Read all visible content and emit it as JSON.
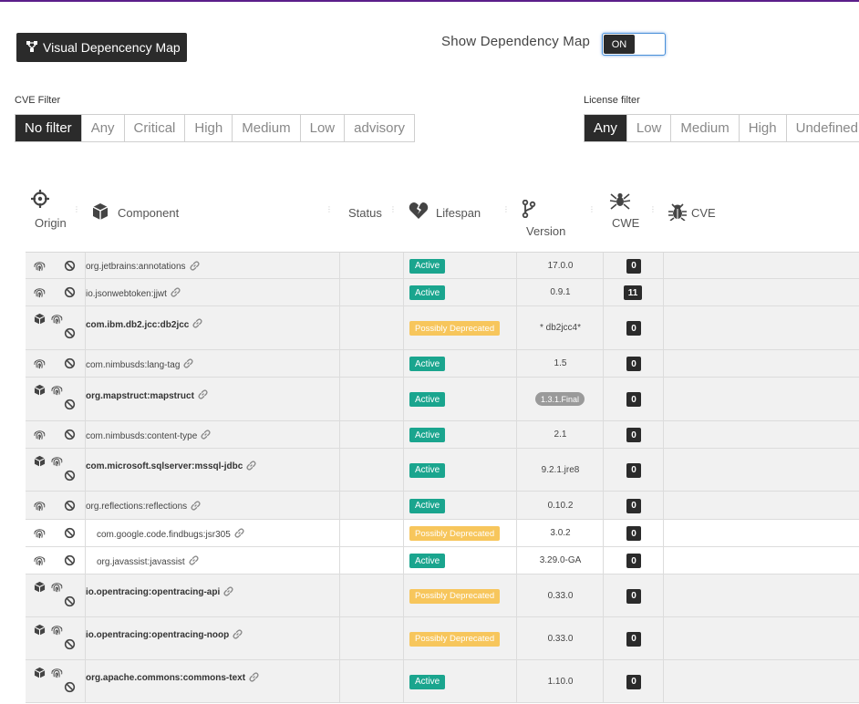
{
  "toolbar": {
    "map_button_label": "Visual Depencency Map",
    "show_map_label": "Show Dependency Map",
    "toggle_state": "ON"
  },
  "cve_filter": {
    "label": "CVE Filter",
    "options": [
      "No filter",
      "Any",
      "Critical",
      "High",
      "Medium",
      "Low",
      "advisory"
    ],
    "selected": "No filter"
  },
  "license_filter": {
    "label": "License filter",
    "options": [
      "Any",
      "Low",
      "Medium",
      "High",
      "Undefined"
    ],
    "selected": "Any"
  },
  "table": {
    "headers": {
      "origin": "Origin",
      "component": "Component",
      "status": "Status",
      "lifespan": "Lifespan",
      "version": "Version",
      "cwe": "CWE",
      "cve": "CVE"
    },
    "rows": [
      {
        "component": "org.jetbrains:annotations",
        "bold": false,
        "indent": false,
        "lifespan": "Active",
        "version": "17.0.0",
        "version_pill": false,
        "cwe": "0",
        "origin_icons": [
          "fingerprint",
          "block"
        ]
      },
      {
        "component": "io.jsonwebtoken:jjwt",
        "bold": false,
        "indent": false,
        "lifespan": "Active",
        "version": "0.9.1",
        "version_pill": false,
        "cwe": "11",
        "origin_icons": [
          "fingerprint",
          "block"
        ]
      },
      {
        "component": "com.ibm.db2.jcc:db2jcc",
        "bold": true,
        "indent": false,
        "lifespan": "Possibly Deprecated",
        "version": "* db2jcc4*",
        "version_pill": false,
        "cwe": "0",
        "origin_icons": [
          "cube",
          "fingerprint",
          "block"
        ]
      },
      {
        "component": "com.nimbusds:lang-tag",
        "bold": false,
        "indent": false,
        "lifespan": "Active",
        "version": "1.5",
        "version_pill": false,
        "cwe": "0",
        "origin_icons": [
          "fingerprint",
          "block"
        ]
      },
      {
        "component": "org.mapstruct:mapstruct",
        "bold": true,
        "indent": false,
        "lifespan": "Active",
        "version": "1.3.1.Final",
        "version_pill": true,
        "cwe": "0",
        "origin_icons": [
          "cube",
          "fingerprint",
          "block"
        ]
      },
      {
        "component": "com.nimbusds:content-type",
        "bold": false,
        "indent": false,
        "lifespan": "Active",
        "version": "2.1",
        "version_pill": false,
        "cwe": "0",
        "origin_icons": [
          "fingerprint",
          "block"
        ]
      },
      {
        "component": "com.microsoft.sqlserver:mssql-jdbc",
        "bold": true,
        "indent": false,
        "lifespan": "Active",
        "version": "9.2.1.jre8",
        "version_pill": false,
        "cwe": "0",
        "origin_icons": [
          "cube",
          "fingerprint",
          "block"
        ]
      },
      {
        "component": "org.reflections:reflections",
        "bold": false,
        "indent": false,
        "lifespan": "Active",
        "version": "0.10.2",
        "version_pill": false,
        "cwe": "0",
        "origin_icons": [
          "fingerprint",
          "block"
        ]
      },
      {
        "component": "com.google.code.findbugs:jsr305",
        "bold": false,
        "indent": true,
        "lifespan": "Possibly Deprecated",
        "version": "3.0.2",
        "version_pill": false,
        "cwe": "0",
        "origin_icons": [
          "fingerprint",
          "block"
        ]
      },
      {
        "component": "org.javassist:javassist",
        "bold": false,
        "indent": true,
        "lifespan": "Active",
        "version": "3.29.0-GA",
        "version_pill": false,
        "cwe": "0",
        "origin_icons": [
          "fingerprint",
          "block"
        ]
      },
      {
        "component": "io.opentracing:opentracing-api",
        "bold": true,
        "indent": false,
        "lifespan": "Possibly Deprecated",
        "version": "0.33.0",
        "version_pill": false,
        "cwe": "0",
        "origin_icons": [
          "cube",
          "fingerprint",
          "block"
        ]
      },
      {
        "component": "io.opentracing:opentracing-noop",
        "bold": true,
        "indent": false,
        "lifespan": "Possibly Deprecated",
        "version": "0.33.0",
        "version_pill": false,
        "cwe": "0",
        "origin_icons": [
          "cube",
          "fingerprint",
          "block"
        ]
      },
      {
        "component": "org.apache.commons:commons-text",
        "bold": true,
        "indent": false,
        "lifespan": "Active",
        "version": "1.10.0",
        "version_pill": false,
        "cwe": "0",
        "origin_icons": [
          "cube",
          "fingerprint",
          "block"
        ]
      }
    ]
  },
  "colors": {
    "active": "#1aa58e",
    "deprecated": "#f7c65c",
    "dark": "#2b2b2b",
    "accent_bar": "#5b1e8a"
  }
}
